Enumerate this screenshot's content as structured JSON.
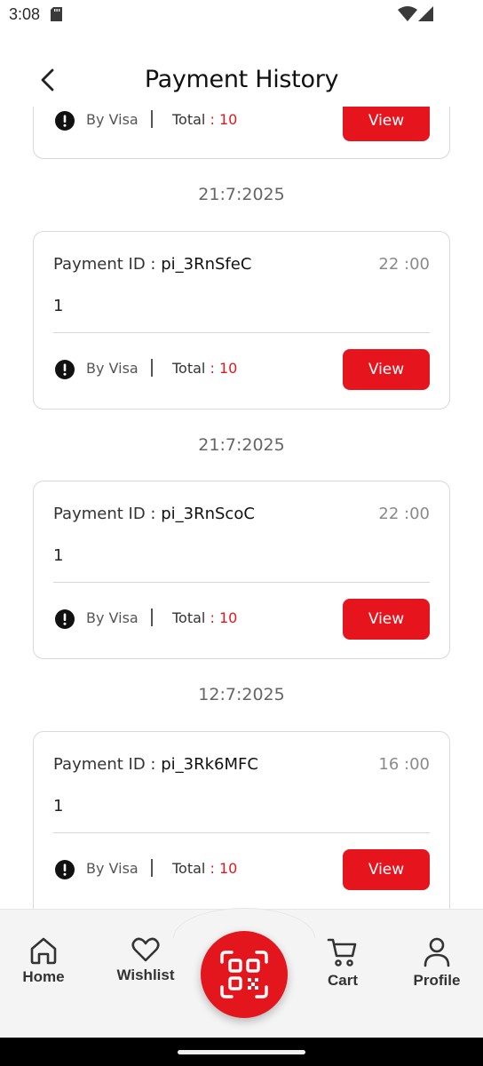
{
  "status_bar": {
    "time": "3:08"
  },
  "header": {
    "title": "Payment History"
  },
  "partial_card": {
    "method": "By Visa",
    "total_label": "Total",
    "total_colon": " : ",
    "total_amount": "10",
    "view_label": "View"
  },
  "groups": [
    {
      "date": "21:7:2025",
      "payment_id_label": "Payment ID : ",
      "payment_id": "pi_3RnSfeC",
      "time": "22 :00",
      "quantity": "1",
      "method": "By Visa",
      "total_label": "Total",
      "total_colon": " : ",
      "total_amount": "10",
      "view_label": "View"
    },
    {
      "date": "21:7:2025",
      "payment_id_label": "Payment ID : ",
      "payment_id": "pi_3RnScoC",
      "time": "22 :00",
      "quantity": "1",
      "method": "By Visa",
      "total_label": "Total",
      "total_colon": " : ",
      "total_amount": "10",
      "view_label": "View"
    },
    {
      "date": "12:7:2025",
      "payment_id_label": "Payment ID : ",
      "payment_id": "pi_3Rk6MFC",
      "time": "16 :00",
      "quantity": "1",
      "method": "By Visa",
      "total_label": "Total",
      "total_colon": " : ",
      "total_amount": "10",
      "view_label": "View"
    }
  ],
  "bottom_nav": {
    "items": [
      {
        "label": "Home",
        "icon": "home-icon"
      },
      {
        "label": "Wishlist",
        "icon": "heart-icon"
      },
      {
        "label": "Cart",
        "icon": "cart-icon"
      },
      {
        "label": "Profile",
        "icon": "profile-icon"
      }
    ],
    "center_icon": "qr-scan-icon"
  },
  "colors": {
    "accent": "#e6141d",
    "text_muted": "#8a8a8a",
    "card_border": "#d9d9d9",
    "nav_background": "#f4f4f4"
  }
}
